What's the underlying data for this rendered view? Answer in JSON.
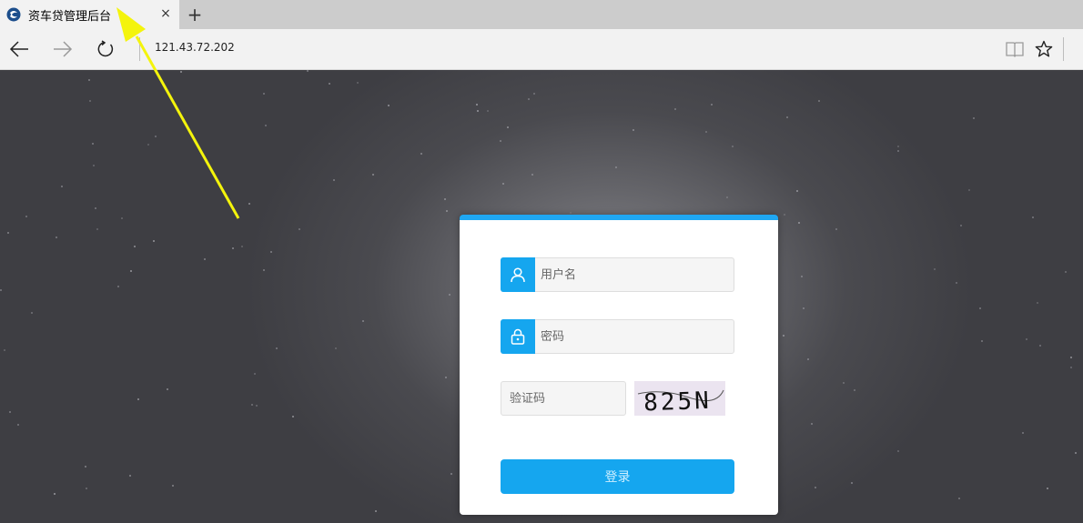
{
  "browser": {
    "tab_title": "资车贷管理后台",
    "tab_close": "×",
    "new_tab": "+",
    "address": "121.43.72.202"
  },
  "login": {
    "username_placeholder": "用户名",
    "password_placeholder": "密码",
    "captcha_placeholder": "验证码",
    "captcha_text": "825N",
    "submit_label": "登录"
  },
  "colors": {
    "accent": "#15a6ef",
    "card_border": "#1fa7f2",
    "annotation_arrow": "#f4f40c"
  },
  "icons": [
    "back-arrow-icon",
    "forward-arrow-icon",
    "refresh-icon",
    "reading-view-icon",
    "favorite-star-icon",
    "user-icon",
    "lock-icon"
  ]
}
